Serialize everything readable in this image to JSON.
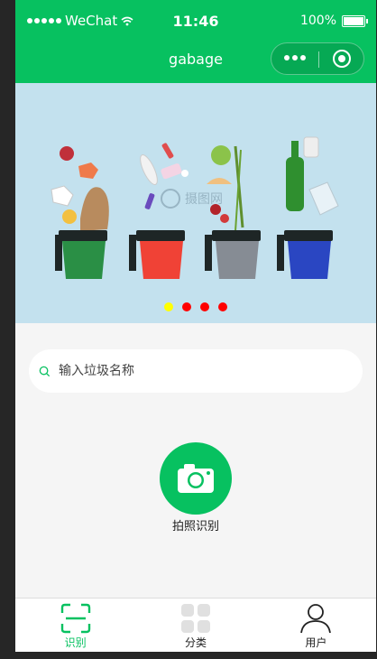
{
  "status_bar": {
    "carrier": "WeChat",
    "time": "11:46",
    "battery": "100%"
  },
  "navbar": {
    "title": "gabage"
  },
  "banner": {
    "watermark": "摄图网",
    "slide_count": 4,
    "active_slide": 1
  },
  "search": {
    "placeholder": "输入垃圾名称",
    "value": ""
  },
  "camera": {
    "label": "拍照识别"
  },
  "tabbar": {
    "items": [
      {
        "label": "识别",
        "icon": "scan-icon",
        "active": true
      },
      {
        "label": "分类",
        "icon": "grid-icon",
        "active": false
      },
      {
        "label": "用户",
        "icon": "user-icon",
        "active": false
      }
    ]
  },
  "colors": {
    "brand": "#07c160",
    "indicator_active": "#ffff00",
    "indicator": "#ff0000"
  }
}
